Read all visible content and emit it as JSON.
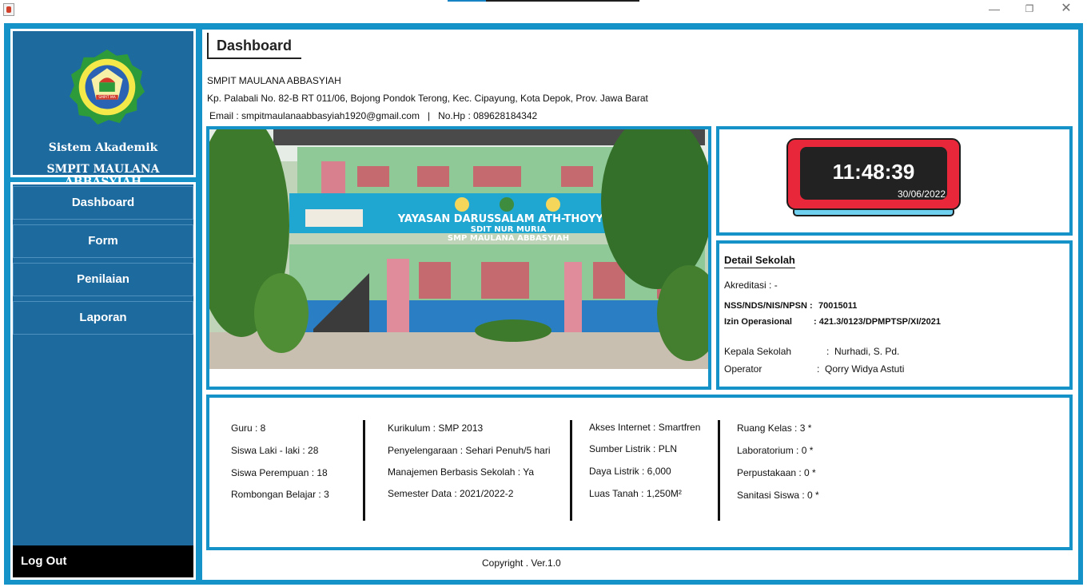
{
  "window": {
    "controls": {
      "minimize": "—",
      "maximize": "❐",
      "close": "✕"
    }
  },
  "sidebar": {
    "logo_text": "SMPIT MA",
    "brand_line1": "Sistem Akademik",
    "brand_line2": "SMPIT MAULANA ABBASYIAH",
    "nav_items": [
      {
        "label": "Dashboard"
      },
      {
        "label": "Form"
      },
      {
        "label": "Penilaian"
      },
      {
        "label": "Laporan"
      }
    ],
    "logout_label": "Log Out"
  },
  "main": {
    "title": "Dashboard",
    "school_name": "SMPIT MAULANA ABBASYIAH",
    "address": "Kp. Palabali No. 82-B RT 011/06, Bojong Pondok Terong, Kec. Cipayung, Kota Depok, Prov. Jawa Barat",
    "contact": "Email : smpitmaulanaabbasyiah1920@gmail.com   |   No.Hp : 089628184342",
    "photo_sign": {
      "line1": "YAYASAN DARUSSALAM ATH-THOYYIBI",
      "line2": "SDIT NUR MURIA",
      "line3": "SMP MAULANA ABBASYIAH"
    },
    "clock": {
      "time": "11:48:39",
      "date": "30/06/2022"
    },
    "detail": {
      "title": "Detail Sekolah",
      "akreditasi": "Akreditasi : -",
      "nss_label": "NSS/NDS/NIS/NPSN :",
      "nss_value": "70015011",
      "izin_label": "Izin Operasional",
      "izin_value": ": 421.3/0123/DPMPTSP/XI/2021",
      "kepala_label": "Kepala Sekolah",
      "kepala_value": ":  Nurhadi, S. Pd.",
      "operator_label": "Operator",
      "operator_value": ":  Qorry Widya Astuti"
    },
    "stats": {
      "col1": [
        "Guru : 8",
        "Siswa Laki - laki : 28",
        "Siswa Perempuan : 18",
        "Rombongan Belajar : 3"
      ],
      "col2": [
        "Kurikulum : SMP 2013",
        "Penyelengaraan : Sehari Penuh/5 hari",
        "Manajemen Berbasis Sekolah : Ya",
        "Semester Data : 2021/2022-2"
      ],
      "col3": [
        "Akses Internet : Smartfren",
        "Sumber Listrik : PLN",
        "Daya Listrik : 6,000",
        "Luas Tanah : 1,250M²"
      ],
      "col4": [
        "Ruang Kelas : 3 *",
        "Laboratorium : 0 *",
        "Perpustakaan : 0 *",
        "Sanitasi Siswa : 0 *"
      ]
    },
    "copyright": "Copyright . Ver.1.0"
  },
  "colors": {
    "accent": "#1593c9",
    "sidebar": "#1d6a9f",
    "logout": "#000000"
  }
}
